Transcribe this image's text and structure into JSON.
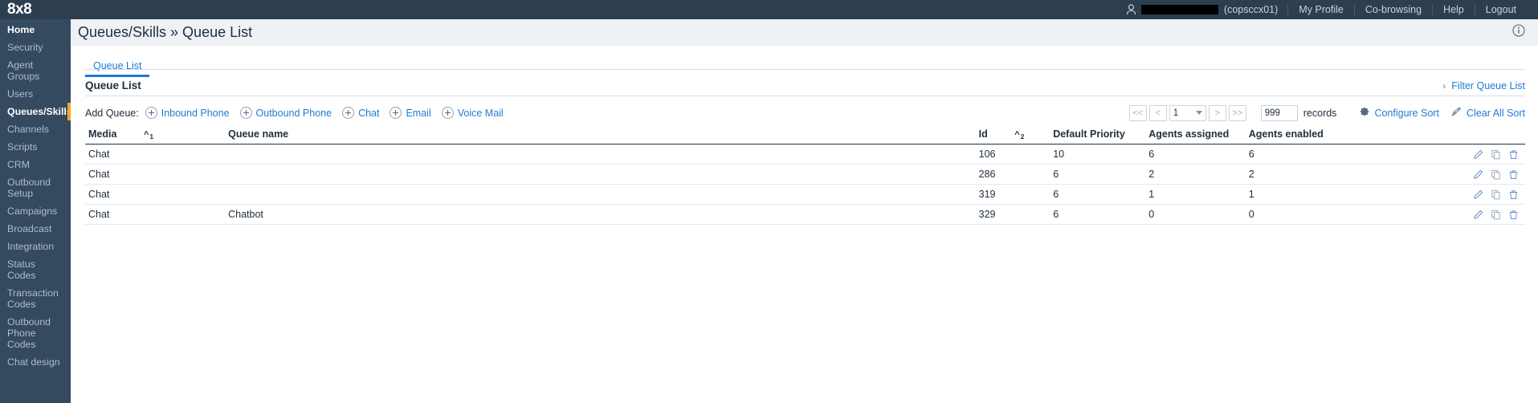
{
  "brand": "8x8",
  "topbar": {
    "user_icon": "user-icon",
    "user_name_redacted": true,
    "user_suffix": "(copsccx01)",
    "links": [
      "My Profile",
      "Co-browsing",
      "Help",
      "Logout"
    ]
  },
  "sidebar": {
    "items": [
      {
        "label": "Home",
        "active": true,
        "marked": false
      },
      {
        "label": "Security",
        "active": false,
        "marked": false
      },
      {
        "label": "Agent Groups",
        "active": false,
        "marked": false
      },
      {
        "label": "Users",
        "active": false,
        "marked": false
      },
      {
        "label": "Queues/Skills",
        "active": true,
        "marked": true
      },
      {
        "label": "Channels",
        "active": false,
        "marked": false
      },
      {
        "label": "Scripts",
        "active": false,
        "marked": false
      },
      {
        "label": "CRM",
        "active": false,
        "marked": false
      },
      {
        "label": "Outbound Setup",
        "active": false,
        "marked": false
      },
      {
        "label": "Campaigns",
        "active": false,
        "marked": false
      },
      {
        "label": "Broadcast",
        "active": false,
        "marked": false
      },
      {
        "label": "Integration",
        "active": false,
        "marked": false
      },
      {
        "label": "Status Codes",
        "active": false,
        "marked": false
      },
      {
        "label": "Transaction Codes",
        "active": false,
        "marked": false
      },
      {
        "label": "Outbound Phone Codes",
        "active": false,
        "marked": false
      },
      {
        "label": "Chat design",
        "active": false,
        "marked": false
      }
    ]
  },
  "page": {
    "title": "Queues/Skills » Queue List",
    "info_icon": "info-icon"
  },
  "tabs": [
    {
      "label": "Queue List",
      "active": true
    }
  ],
  "panel": {
    "title": "Queue List",
    "chevron": "›",
    "filter_link": "Filter Queue List"
  },
  "toolbar": {
    "add_label": "Add Queue:",
    "add_buttons": [
      "Inbound Phone",
      "Outbound Phone",
      "Chat",
      "Email",
      "Voice Mail"
    ],
    "pager": {
      "first": "<<",
      "prev": "<",
      "page_value": "1",
      "next": ">",
      "last": ">>"
    },
    "records_value": "999",
    "records_label": "records",
    "configure_sort": "Configure Sort",
    "configure_sort_icon": "gear-icon",
    "clear_all_sort": "Clear All Sort",
    "clear_all_sort_icon": "broom-icon"
  },
  "table": {
    "columns": [
      {
        "label": "Media",
        "sort": "^",
        "sort_order": "1"
      },
      {
        "label": "Queue name",
        "sort": "",
        "sort_order": ""
      },
      {
        "label": "Id",
        "sort": "^",
        "sort_order": "2"
      },
      {
        "label": "Default Priority",
        "sort": "",
        "sort_order": ""
      },
      {
        "label": "Agents assigned",
        "sort": "",
        "sort_order": ""
      },
      {
        "label": "Agents enabled",
        "sort": "",
        "sort_order": ""
      }
    ],
    "row_action_icons": [
      "edit-pencil-icon",
      "copy-icon",
      "delete-trash-icon"
    ],
    "rows": [
      {
        "media": "Chat",
        "queue_name": "",
        "queue_name_redacted": true,
        "id": "106",
        "default_priority": "10",
        "agents_assigned": "6",
        "agents_enabled": "6"
      },
      {
        "media": "Chat",
        "queue_name": "",
        "queue_name_redacted": true,
        "id": "286",
        "default_priority": "6",
        "agents_assigned": "2",
        "agents_enabled": "2"
      },
      {
        "media": "Chat",
        "queue_name": "",
        "queue_name_redacted": true,
        "id": "319",
        "default_priority": "6",
        "agents_assigned": "1",
        "agents_enabled": "1"
      },
      {
        "media": "Chat",
        "queue_name": "Chatbot",
        "queue_name_redacted": false,
        "id": "329",
        "default_priority": "6",
        "agents_assigned": "0",
        "agents_enabled": "0"
      }
    ]
  },
  "colors": {
    "brand_dark": "#2c3e50",
    "sidebar": "#344a5f",
    "accent_blue": "#1f7ad4",
    "accent_yellow": "#f0a828",
    "header_bg": "#eef1f6"
  }
}
